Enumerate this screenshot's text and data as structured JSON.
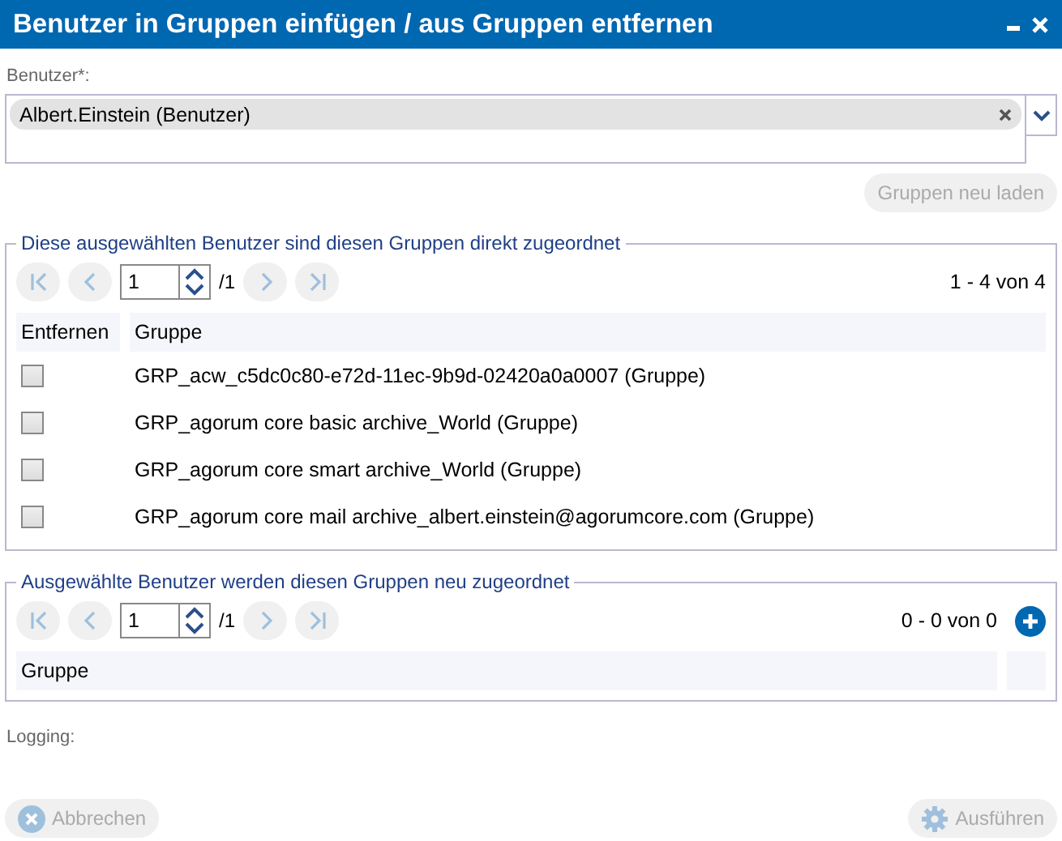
{
  "window": {
    "title": "Benutzer in Gruppen einfügen / aus Gruppen entfernen"
  },
  "user_field": {
    "label": "Benutzer*:",
    "tags": [
      {
        "text": "Albert.Einstein (Benutzer)"
      }
    ]
  },
  "reload_button": {
    "label": "Gruppen neu laden",
    "disabled": true
  },
  "assigned": {
    "legend": "Diese ausgewählten Benutzer sind diesen Gruppen direkt zugeordnet",
    "pager": {
      "page": "1",
      "total": "/1",
      "range": "1 - 4 von 4"
    },
    "columns": [
      "Entfernen",
      "Gruppe"
    ],
    "rows": [
      {
        "remove": false,
        "group": "GRP_acw_c5dc0c80-e72d-11ec-9b9d-02420a0a0007 (Gruppe)"
      },
      {
        "remove": false,
        "group": "GRP_agorum core basic archive_World (Gruppe)"
      },
      {
        "remove": false,
        "group": "GRP_agorum core smart archive_World (Gruppe)"
      },
      {
        "remove": false,
        "group": "GRP_agorum core mail archive_albert.einstein@agorumcore.com (Gruppe)"
      }
    ]
  },
  "new_assignments": {
    "legend": "Ausgewählte Benutzer werden diesen Gruppen neu zugeordnet",
    "pager": {
      "page": "1",
      "total": "/1",
      "range": "0 - 0 von 0"
    },
    "columns": [
      "Gruppe"
    ]
  },
  "logging": {
    "label": "Logging:"
  },
  "footer": [
    {
      "kind": "cancel",
      "label": "Abbrechen",
      "disabled": true
    },
    {
      "kind": "run",
      "label": "Ausführen",
      "disabled": true
    }
  ]
}
